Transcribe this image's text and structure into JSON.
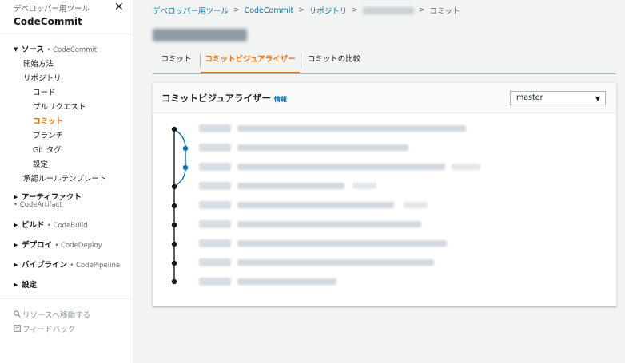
{
  "sidebar": {
    "subtitle": "デベロッパー用ツール",
    "title": "CodeCommit",
    "sections": {
      "source": {
        "label": "ソース",
        "service": "• CodeCommit"
      },
      "artifacts": {
        "label": "アーティファクト",
        "service": "• CodeArtifact"
      },
      "build": {
        "label": "ビルド",
        "service": "• CodeBuild"
      },
      "deploy": {
        "label": "デプロイ",
        "service": "• CodeDeploy"
      },
      "pipeline": {
        "label": "パイプライン",
        "service": "• CodePipeline"
      },
      "settings": {
        "label": "設定"
      }
    },
    "items": {
      "getting_started": "開始方法",
      "repositories": "リポジトリ",
      "code": "コード",
      "pull_requests": "プルリクエスト",
      "commits": "コミット",
      "branches": "ブランチ",
      "git_tags": "Git タグ",
      "repo_settings": "設定",
      "approval_templates": "承認ルールテンプレート"
    },
    "footer": {
      "go_to_resource": "リソースへ移動する",
      "feedback": "フィードバック"
    }
  },
  "breadcrumb": {
    "dev_tools": "デベロッパー用ツール",
    "codecommit": "CodeCommit",
    "repositories": "リポジトリ",
    "current": "コミット"
  },
  "tabs": {
    "commits": "コミット",
    "visualizer": "コミットビジュアライザー",
    "compare": "コミットの比較"
  },
  "panel": {
    "title": "コミットビジュアライザー",
    "info": "情報",
    "branch_selected": "master"
  },
  "colors": {
    "accent": "#ec7211",
    "link": "#0073bb",
    "graph_main": "#16191f",
    "graph_branch": "#0073bb"
  },
  "icons": {
    "close": "close-icon",
    "search": "search-icon",
    "feedback": "feedback-icon",
    "chevron": "chevron-right-icon",
    "caret": "caret-down-icon"
  }
}
